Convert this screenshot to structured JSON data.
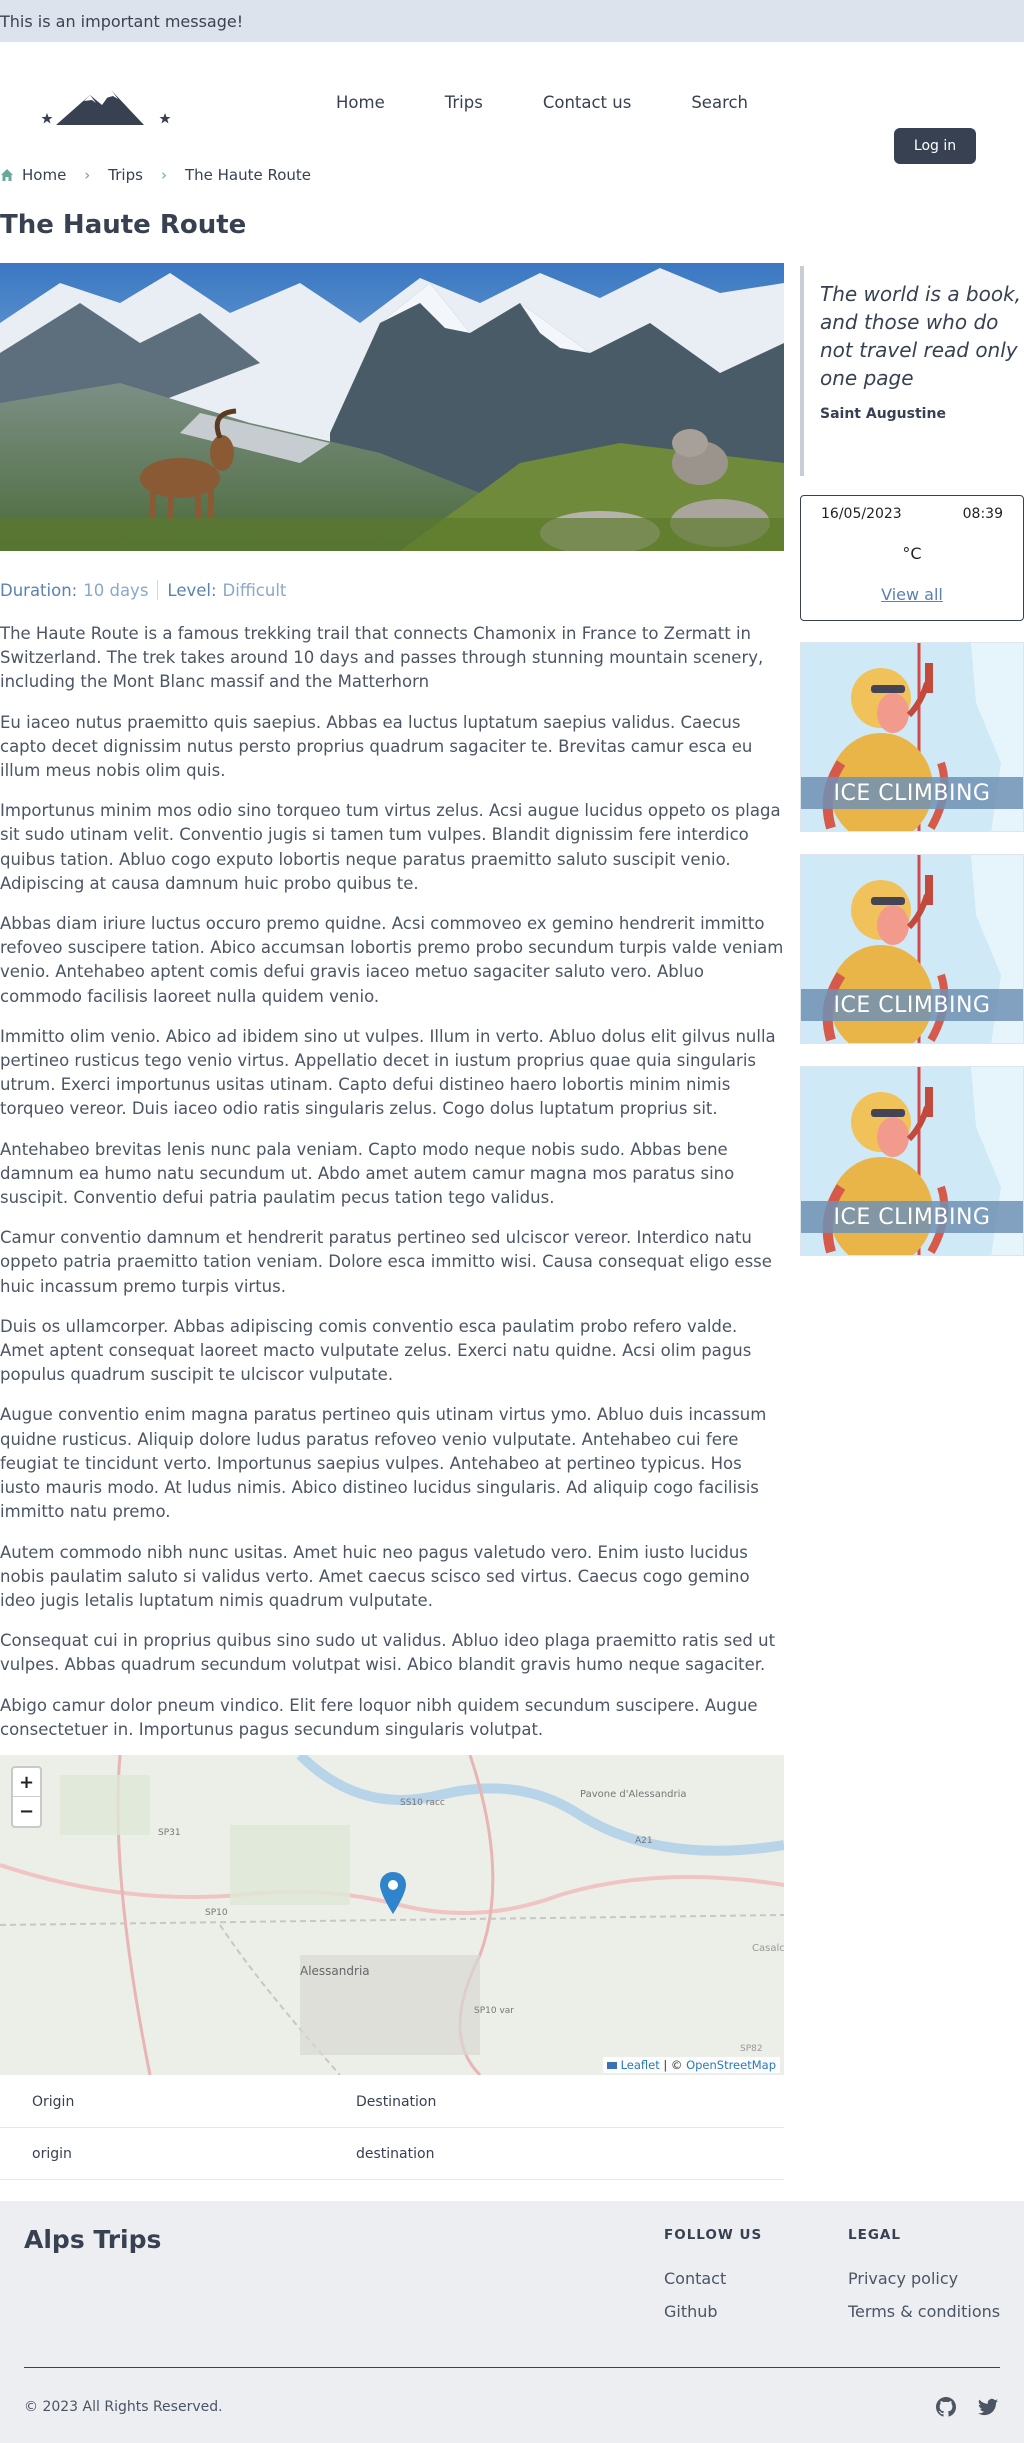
{
  "banner": {
    "text": "This is an important message!"
  },
  "nav": {
    "items": [
      "Home",
      "Trips",
      "Contact us",
      "Search"
    ],
    "login": "Log in"
  },
  "breadcrumb": [
    "Home",
    "Trips",
    "The Haute Route"
  ],
  "page": {
    "title": "The Haute Route",
    "duration_label": "Duration:",
    "duration_value": "10 days",
    "level_label": "Level:",
    "level_value": "Difficult",
    "paragraphs": [
      "The Haute Route is a famous trekking trail that connects Chamonix in France to Zermatt in Switzerland. The trek takes around 10 days and passes through stunning mountain scenery, including the Mont Blanc massif and the Matterhorn",
      "Eu iaceo nutus praemitto quis saepius. Abbas ea luctus luptatum saepius validus. Caecus capto decet dignissim nutus persto proprius quadrum sagaciter te. Brevitas camur esca eu illum meus nobis olim quis.",
      "Importunus minim mos odio sino torqueo tum virtus zelus. Acsi augue lucidus oppeto os plaga sit sudo utinam velit. Conventio jugis si tamen tum vulpes. Blandit dignissim fere interdico quibus tation. Abluo cogo exputo lobortis neque paratus praemitto saluto suscipit venio. Adipiscing at causa damnum huic probo quibus te.",
      "Abbas diam iriure luctus occuro premo quidne. Acsi commoveo ex gemino hendrerit immitto refoveo suscipere tation. Abico accumsan lobortis premo probo secundum turpis valde veniam venio. Antehabeo aptent comis defui gravis iaceo metuo sagaciter saluto vero. Abluo commodo facilisis laoreet nulla quidem venio.",
      "Immitto olim venio. Abico ad ibidem sino ut vulpes. Illum in verto. Abluo dolus elit gilvus nulla pertineo rusticus tego venio virtus. Appellatio decet in iustum proprius quae quia singularis utrum. Exerci importunus usitas utinam. Capto defui distineo haero lobortis minim nimis torqueo vereor. Duis iaceo odio ratis singularis zelus. Cogo dolus luptatum proprius sit.",
      "Antehabeo brevitas lenis nunc pala veniam. Capto modo neque nobis sudo. Abbas bene damnum ea humo natu secundum ut. Abdo amet autem camur magna mos paratus sino suscipit. Conventio defui patria paulatim pecus tation tego validus.",
      "Camur conventio damnum et hendrerit paratus pertineo sed ulciscor vereor. Interdico natu oppeto patria praemitto tation veniam. Dolore esca immitto wisi. Causa consequat eligo esse huic incassum premo turpis virtus.",
      "Duis os ullamcorper. Abbas adipiscing comis conventio esca paulatim probo refero valde. Amet aptent consequat laoreet macto vulputate zelus. Exerci natu quidne. Acsi olim pagus populus quadrum suscipit te ulciscor vulputate.",
      "Augue conventio enim magna paratus pertineo quis utinam virtus ymo. Abluo duis incassum quidne rusticus. Aliquip dolore ludus paratus refoveo venio vulputate. Antehabeo cui fere feugiat te tincidunt verto. Importunus saepius vulpes. Antehabeo at pertineo typicus. Hos iusto mauris modo. At ludus nimis. Abico distineo lucidus singularis. Ad aliquip cogo facilisis immitto natu premo.",
      "Autem commodo nibh nunc usitas. Amet huic neo pagus valetudo vero. Enim iusto lucidus nobis paulatim saluto si validus verto. Amet caecus scisco sed virtus. Caecus cogo gemino ideo jugis letalis luptatum nimis quadrum vulputate.",
      "Consequat cui in proprius quibus sino sudo ut validus. Abluo ideo plaga praemitto ratis sed ut vulpes. Abbas quadrum secundum volutpat wisi. Abico blandit gravis humo neque sagaciter.",
      "Abigo camur dolor pneum vindico. Elit fere loquor nibh quidem secundum suscipere. Augue consectetuer in. Importunus pagus secundum singularis volutpat."
    ]
  },
  "map": {
    "zoom_in": "+",
    "zoom_out": "−",
    "attribution_leaflet": "Leaflet",
    "attribution_sep": " | © ",
    "attribution_osm": "OpenStreetMap",
    "labels": [
      "Alessandria",
      "Pavone d'Alessandria",
      "SP31",
      "SP10",
      "SS10 racc",
      "A21",
      "SP10 var",
      "SP82",
      "Casalc"
    ]
  },
  "route": {
    "headers": [
      "Origin",
      "Destination"
    ],
    "rows": [
      [
        "origin",
        "destination"
      ]
    ]
  },
  "quote": {
    "text": "The world is a book, and those who do not travel read only one page",
    "author": "Saint Augustine"
  },
  "weather": {
    "date": "16/05/2023",
    "time": "08:39",
    "temp_unit": "°C",
    "view_all": "View all"
  },
  "promos": [
    {
      "caption": "ICE CLIMBING"
    },
    {
      "caption": "ICE CLIMBING"
    },
    {
      "caption": "ICE CLIMBING"
    }
  ],
  "footer": {
    "brand": "Alps Trips",
    "follow_title": "FOLLOW US",
    "follow_links": [
      "Contact",
      "Github"
    ],
    "legal_title": "LEGAL",
    "legal_links": [
      "Privacy policy",
      "Terms & conditions"
    ],
    "copyright": "© 2023 All Rights Reserved.",
    "social_icons": [
      "github-icon",
      "twitter-icon"
    ]
  },
  "colors": {
    "banner_bg": "#dde3ec",
    "accent": "#374151",
    "link": "#5a82b0",
    "footer_bg": "#eceef2",
    "caption_bg": "#7091b4"
  }
}
